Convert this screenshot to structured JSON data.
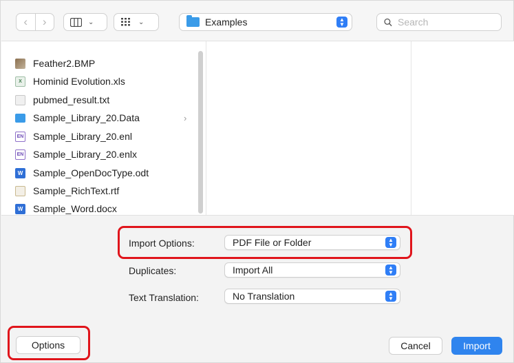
{
  "toolbar": {
    "back_icon": "chevron-left-icon",
    "forward_icon": "chevron-right-icon",
    "column_view_icon": "column-view-icon",
    "grid_view_icon": "grid-view-icon",
    "location": "Examples",
    "search_placeholder": "Search"
  },
  "files": [
    {
      "name": "Feather2.BMP",
      "icon": "image-file-icon"
    },
    {
      "name": "Hominid Evolution.xls",
      "icon": "spreadsheet-file-icon"
    },
    {
      "name": "pubmed_result.txt",
      "icon": "text-file-icon"
    },
    {
      "name": "Sample_Library_20.Data",
      "icon": "folder-icon",
      "has_children": true
    },
    {
      "name": "Sample_Library_20.enl",
      "icon": "endnote-library-icon"
    },
    {
      "name": "Sample_Library_20.enlx",
      "icon": "endnote-library-icon"
    },
    {
      "name": "Sample_OpenDocType.odt",
      "icon": "document-file-icon"
    },
    {
      "name": "Sample_RichText.rtf",
      "icon": "rich-text-file-icon"
    },
    {
      "name": "Sample_Word.docx",
      "icon": "word-file-icon"
    }
  ],
  "options": {
    "import_options_label": "Import Options:",
    "import_options_value": "PDF File or Folder",
    "duplicates_label": "Duplicates:",
    "duplicates_value": "Import All",
    "text_translation_label": "Text Translation:",
    "text_translation_value": "No Translation"
  },
  "buttons": {
    "options": "Options",
    "cancel": "Cancel",
    "import": "Import"
  },
  "colors": {
    "accent": "#2f84ee",
    "highlight": "#e0141b",
    "folder": "#3a9be8"
  }
}
